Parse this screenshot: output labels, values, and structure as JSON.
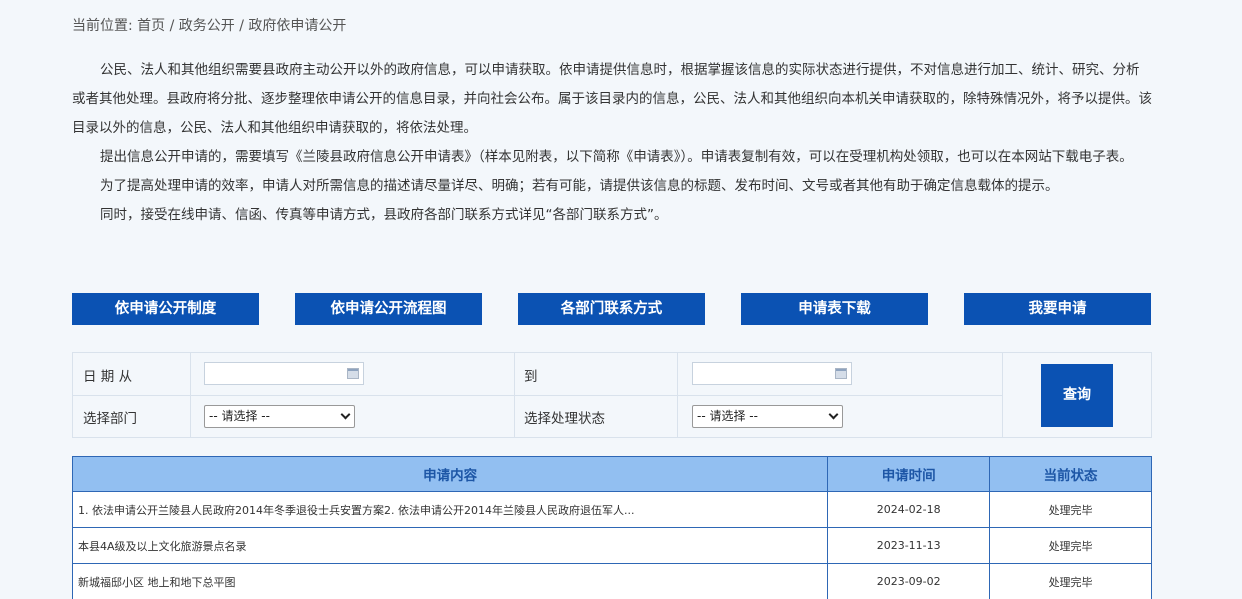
{
  "breadcrumb": {
    "text": "当前位置: 首页 / 政务公开 / 政府依申请公开"
  },
  "intro": {
    "p1": "公民、法人和其他组织需要县政府主动公开以外的政府信息，可以申请获取。依申请提供信息时，根据掌握该信息的实际状态进行提供，不对信息进行加工、统计、研究、分析或者其他处理。县政府将分批、逐步整理依申请公开的信息目录，并向社会公布。属于该目录内的信息，公民、法人和其他组织向本机关申请获取的，除特殊情况外，将予以提供。该目录以外的信息，公民、法人和其他组织申请获取的，将依法处理。",
    "p2": "提出信息公开申请的，需要填写《兰陵县政府信息公开申请表》（样本见附表，以下简称《申请表》）。申请表复制有效，可以在受理机构处领取，也可以在本网站下载电子表。",
    "p3": "为了提高处理申请的效率，申请人对所需信息的描述请尽量详尽、明确；若有可能，请提供该信息的标题、发布时间、文号或者其他有助于确定信息载体的提示。",
    "p4": "同时，接受在线申请、信函、传真等申请方式，县政府各部门联系方式详见“各部门联系方式”。"
  },
  "buttons": {
    "system": "依申请公开制度",
    "flow": "依申请公开流程图",
    "contacts": "各部门联系方式",
    "download": "申请表下载",
    "apply": "我要申请"
  },
  "search": {
    "date_from_label": "日 期 从",
    "date_to_label": "到",
    "dept_label": "选择部门",
    "status_label": "选择处理状态",
    "dept_selected": "-- 请选择 --",
    "status_selected": "-- 请选择 --",
    "query_label": "查询"
  },
  "table": {
    "headers": {
      "content": "申请内容",
      "time": "申请时间",
      "status": "当前状态"
    },
    "rows": [
      {
        "content": "1. 依法申请公开兰陵县人民政府2014年冬季退役士兵安置方案2. 依法申请公开2014年兰陵县人民政府退伍军人...",
        "time": "2024-02-18",
        "status": "处理完毕"
      },
      {
        "content": "本县4A级及以上文化旅游景点名录",
        "time": "2023-11-13",
        "status": "处理完毕"
      },
      {
        "content": "新城福邸小区 地上和地下总平图",
        "time": "2023-09-02",
        "status": "处理完毕"
      }
    ]
  }
}
